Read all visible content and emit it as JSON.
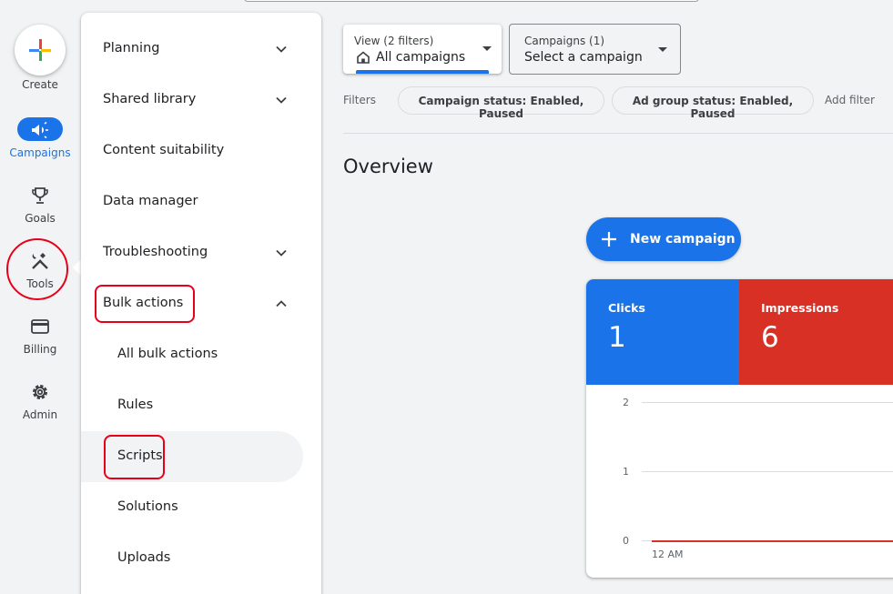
{
  "rail": {
    "create": "Create",
    "items": [
      {
        "label": "Campaigns",
        "icon": "megaphone-icon",
        "active": true
      },
      {
        "label": "Goals",
        "icon": "trophy-icon"
      },
      {
        "label": "Tools",
        "icon": "tools-icon"
      },
      {
        "label": "Billing",
        "icon": "credit-card-icon"
      },
      {
        "label": "Admin",
        "icon": "gear-icon"
      }
    ]
  },
  "menu": {
    "items": [
      {
        "label": "Planning",
        "expandable": true
      },
      {
        "label": "Shared library",
        "expandable": true
      },
      {
        "label": "Content suitability"
      },
      {
        "label": "Data manager"
      },
      {
        "label": "Troubleshooting",
        "expandable": true
      },
      {
        "label": "Bulk actions",
        "expanded": true
      },
      {
        "label": "All bulk actions",
        "sub": true
      },
      {
        "label": "Rules",
        "sub": true
      },
      {
        "label": "Scripts",
        "sub": true,
        "selected": true
      },
      {
        "label": "Solutions",
        "sub": true
      },
      {
        "label": "Uploads",
        "sub": true
      }
    ]
  },
  "view": {
    "small": "View (2 filters)",
    "value": "All campaigns"
  },
  "campaigns": {
    "small": "Campaigns (1)",
    "value": "Select a campaign"
  },
  "filters": {
    "label": "Filters",
    "chips": [
      "Campaign status: Enabled, Paused",
      "Ad group status: Enabled, Paused"
    ],
    "add": "Add filter"
  },
  "overview": {
    "title": "Overview",
    "new_campaign": "New campaign"
  },
  "metrics": [
    {
      "name": "Clicks",
      "value": "1",
      "color": "#1a73e8"
    },
    {
      "name": "Impressions",
      "value": "6",
      "color": "#d93025"
    }
  ],
  "chart_data": {
    "type": "line",
    "y_ticks": [
      "2",
      "1",
      "0"
    ],
    "x_ticks": [
      "12 AM"
    ],
    "ylim": [
      0,
      2
    ],
    "series": [
      {
        "values": [
          0,
          0
        ]
      }
    ]
  },
  "colors": {
    "accent": "#1a73e8",
    "red": "#d93025",
    "annotation": "#e8001a"
  }
}
